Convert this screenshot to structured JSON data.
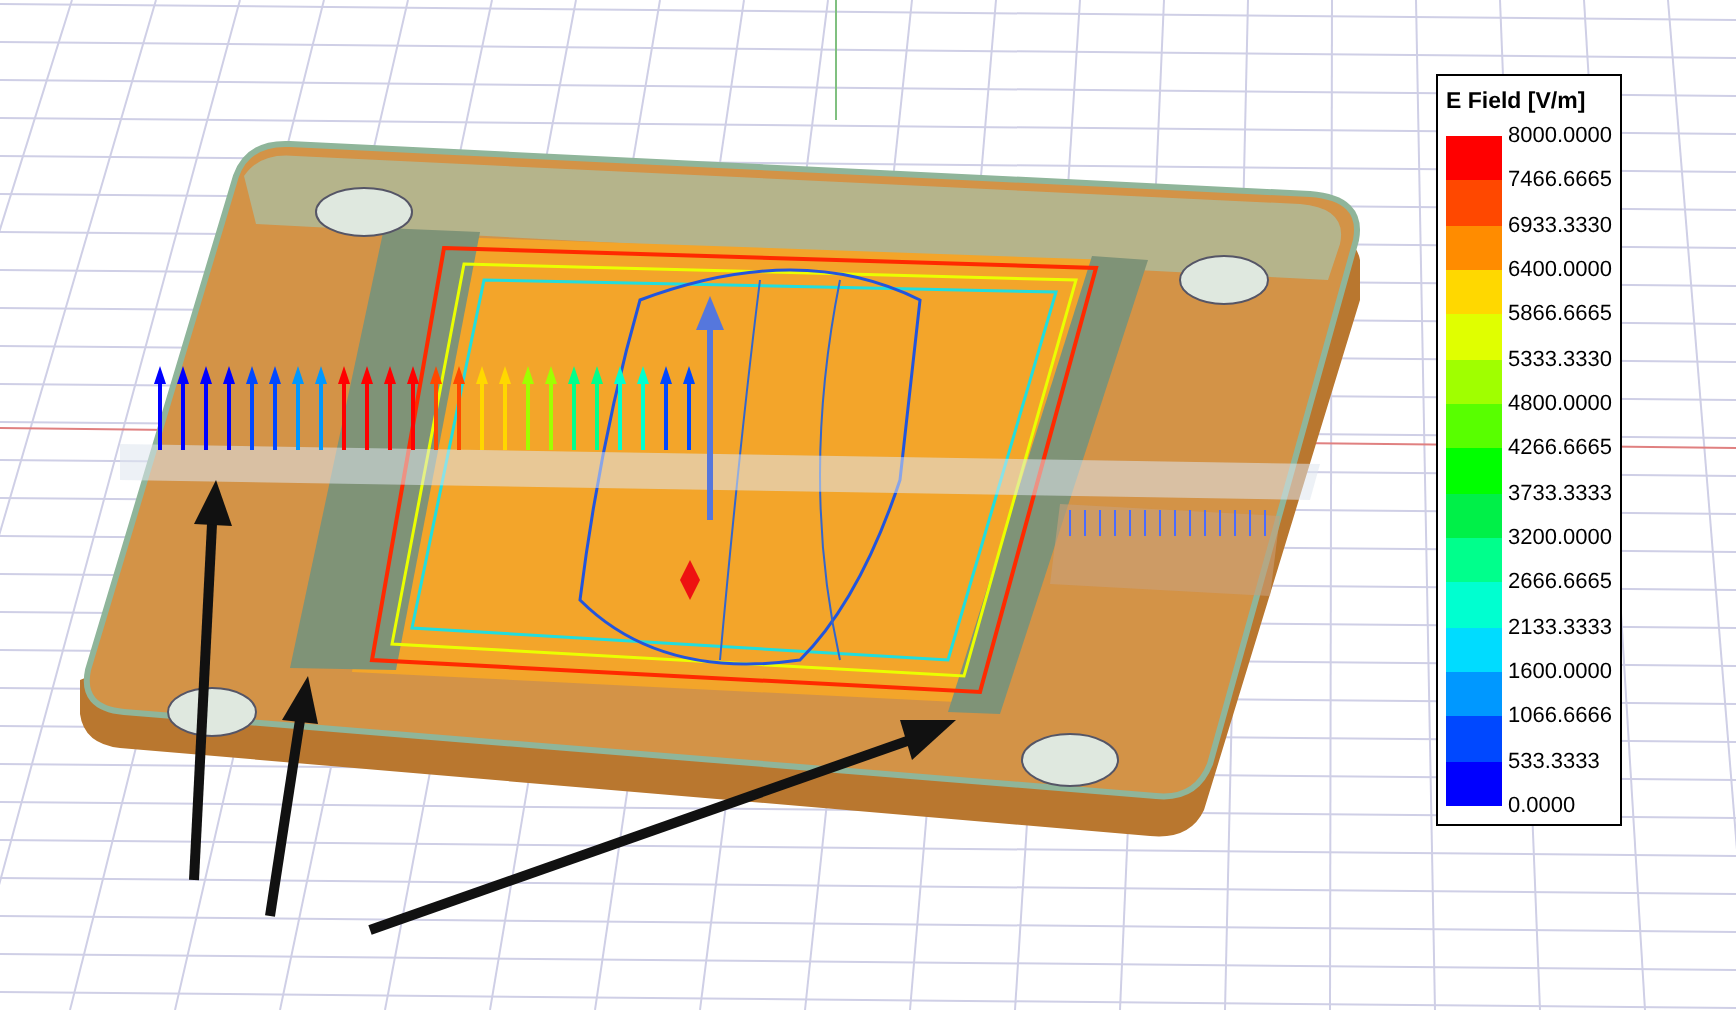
{
  "legend": {
    "title": "E Field [V/m]",
    "bands": [
      {
        "color": "#ff0000"
      },
      {
        "color": "#ff4800"
      },
      {
        "color": "#ff8c00"
      },
      {
        "color": "#ffd800"
      },
      {
        "color": "#e0ff00"
      },
      {
        "color": "#a0ff00"
      },
      {
        "color": "#58ff00"
      },
      {
        "color": "#00ff00"
      },
      {
        "color": "#00f048"
      },
      {
        "color": "#00ff8c"
      },
      {
        "color": "#00ffd0"
      },
      {
        "color": "#00dcff"
      },
      {
        "color": "#0098ff"
      },
      {
        "color": "#0048ff"
      },
      {
        "color": "#0000ff"
      }
    ],
    "labels": [
      "8000.0000",
      "7466.6665",
      "6933.3330",
      "6400.0000",
      "5866.6665",
      "5333.3330",
      "4800.0000",
      "4266.6665",
      "3733.3333",
      "3200.0000",
      "2666.6665",
      "2133.3333",
      "1600.0000",
      "1066.6666",
      "533.3333",
      "0.0000"
    ]
  }
}
